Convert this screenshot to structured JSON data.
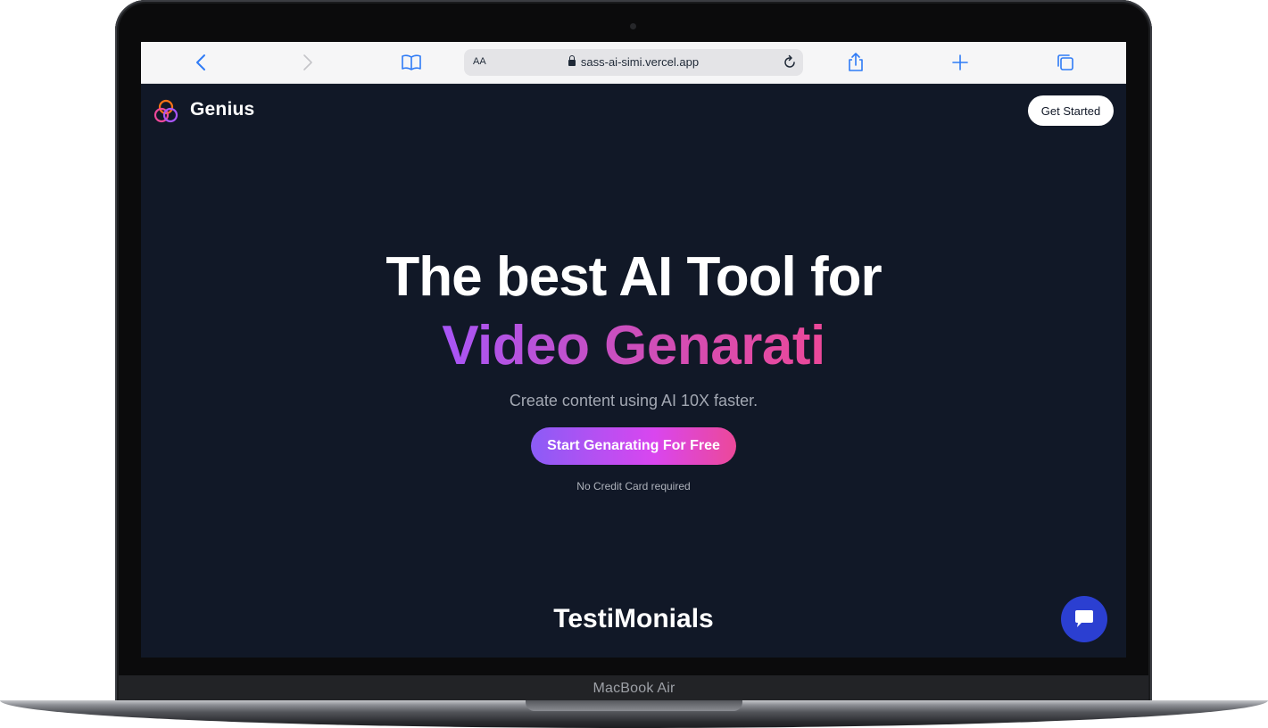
{
  "device": {
    "label": "MacBook Air"
  },
  "browser": {
    "text_size_label": "AA",
    "url": "sass-ai-simi.vercel.app",
    "icons": [
      "back-icon",
      "forward-icon",
      "bookmarks-icon",
      "lock-icon",
      "reload-icon",
      "share-icon",
      "new-tab-icon",
      "tabs-icon"
    ]
  },
  "page": {
    "brand": "Genius",
    "nav_button": "Get Started",
    "headline": "The best AI Tool for",
    "typing_text": "Video Genarati",
    "subtitle": "Create content using AI 10X faster.",
    "cta": "Start Genarating For Free",
    "note": "No Credit Card required",
    "section_title": "TestiMonials"
  },
  "colors": {
    "page_background": "#111827",
    "accent_gradient_start": "#8b5cf6",
    "accent_gradient_end": "#ec4899",
    "chat_button": "#2b3fd1"
  }
}
